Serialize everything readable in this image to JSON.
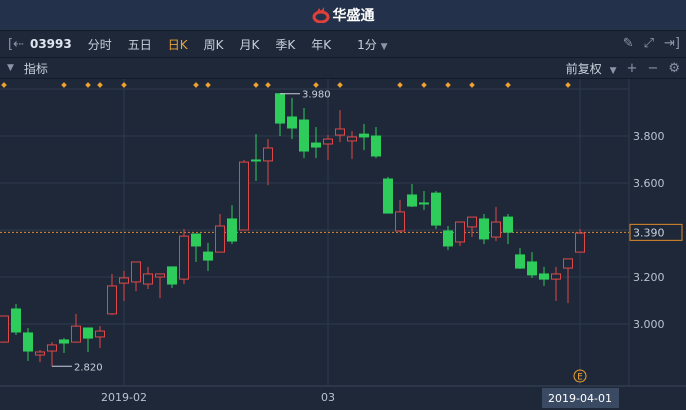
{
  "app": {
    "title": "华盛通"
  },
  "toolbar": {
    "code": "03993",
    "tabs": [
      "分时",
      "五日",
      "日K",
      "周K",
      "月K",
      "季K",
      "年K"
    ],
    "active_tab": "日K",
    "interval": "1分"
  },
  "indicator_bar": {
    "label": "指标",
    "adjust": "前复权"
  },
  "colors": {
    "up": "#e04848",
    "down": "#2ecc5a",
    "grid": "#2d3a4f",
    "marker": "#f0a030",
    "last": "#e08a2a"
  },
  "chart_data": {
    "type": "candlestick",
    "ylim": [
      2.76,
      4.03
    ],
    "yticks": [
      "3.000",
      "3.200",
      "3.600",
      "3.800"
    ],
    "ytick_values": [
      3.0,
      3.2,
      3.6,
      3.8
    ],
    "last_price": "3.390",
    "last_value": 3.39,
    "high_label": "3.980",
    "high_index": 23,
    "low_label": "2.820",
    "low_index": 4,
    "xticks": [
      {
        "label": "2019-02",
        "index": 10
      },
      {
        "label": "03",
        "index": 27
      }
    ],
    "cursor_date": "2019-04-01",
    "cursor_index": 48,
    "event_marker": "E",
    "event_index": 47,
    "marker_indices": [
      0,
      5,
      7,
      8,
      10,
      16,
      17,
      21,
      22,
      26,
      28,
      33,
      35,
      37,
      39,
      42,
      47
    ],
    "candles": [
      [
        2.923,
        3.034,
        3.036,
        2.92
      ],
      [
        3.064,
        2.966,
        3.085,
        2.953
      ],
      [
        2.962,
        2.885,
        2.983,
        2.843
      ],
      [
        2.868,
        2.881,
        2.89,
        2.838
      ],
      [
        2.885,
        2.911,
        2.923,
        2.82
      ],
      [
        2.932,
        2.919,
        2.94,
        2.877
      ],
      [
        2.923,
        2.991,
        3.043,
        2.92
      ],
      [
        2.983,
        2.94,
        2.983,
        2.881
      ],
      [
        2.945,
        2.97,
        2.991,
        2.898
      ],
      [
        3.043,
        3.162,
        3.213,
        3.038
      ],
      [
        3.174,
        3.196,
        3.226,
        3.098
      ],
      [
        3.179,
        3.264,
        3.264,
        3.14
      ],
      [
        3.17,
        3.213,
        3.243,
        3.149
      ],
      [
        3.2,
        3.213,
        3.213,
        3.11
      ],
      [
        3.243,
        3.17,
        3.243,
        3.153
      ],
      [
        3.191,
        3.374,
        3.404,
        3.17
      ],
      [
        3.383,
        3.332,
        3.383,
        3.264
      ],
      [
        3.306,
        3.272,
        3.345,
        3.226
      ],
      [
        3.306,
        3.417,
        3.468,
        3.306
      ],
      [
        3.447,
        3.353,
        3.506,
        3.34
      ],
      [
        3.4,
        3.689,
        3.698,
        3.4
      ],
      [
        3.698,
        3.694,
        3.808,
        3.609
      ],
      [
        3.694,
        3.749,
        3.787,
        3.591
      ],
      [
        3.98,
        3.855,
        3.98,
        3.8
      ],
      [
        3.881,
        3.834,
        3.962,
        3.787
      ],
      [
        3.868,
        3.736,
        3.919,
        3.706
      ],
      [
        3.77,
        3.753,
        3.838,
        3.706
      ],
      [
        3.766,
        3.787,
        3.804,
        3.698
      ],
      [
        3.804,
        3.83,
        3.91,
        3.774
      ],
      [
        3.779,
        3.796,
        3.821,
        3.702
      ],
      [
        3.808,
        3.796,
        3.851,
        3.74
      ],
      [
        3.8,
        3.715,
        3.838,
        3.706
      ],
      [
        3.617,
        3.472,
        3.626,
        3.472
      ],
      [
        3.396,
        3.477,
        3.528,
        3.391
      ],
      [
        3.549,
        3.502,
        3.596,
        3.498
      ],
      [
        3.515,
        3.511,
        3.566,
        3.485
      ],
      [
        3.557,
        3.421,
        3.566,
        3.404
      ],
      [
        3.396,
        3.332,
        3.417,
        3.315
      ],
      [
        3.349,
        3.434,
        3.434,
        3.332
      ],
      [
        3.413,
        3.455,
        3.455,
        3.37
      ],
      [
        3.447,
        3.362,
        3.468,
        3.34
      ],
      [
        3.37,
        3.434,
        3.498,
        3.353
      ],
      [
        3.455,
        3.391,
        3.468,
        3.34
      ],
      [
        3.294,
        3.238,
        3.323,
        3.234
      ],
      [
        3.264,
        3.209,
        3.306,
        3.196
      ],
      [
        3.213,
        3.191,
        3.243,
        3.162
      ],
      [
        3.191,
        3.213,
        3.243,
        3.098
      ],
      [
        3.238,
        3.277,
        3.277,
        3.089
      ],
      [
        3.306,
        3.387,
        3.404,
        3.306
      ]
    ]
  }
}
